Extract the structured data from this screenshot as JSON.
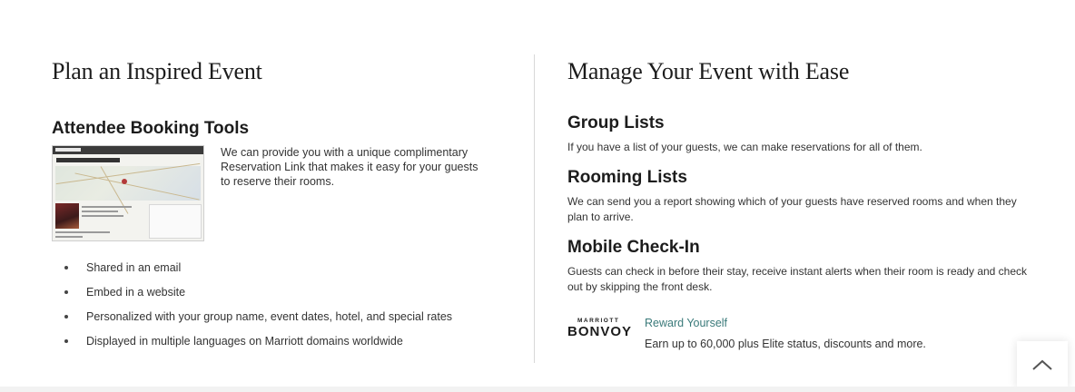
{
  "left": {
    "title": "Plan an Inspired Event",
    "subtitle": "Attendee Booking Tools",
    "description": "We can provide you with a unique complimentary Reservation Link that makes it easy for your guests to reserve their rooms.",
    "bullets": [
      "Shared in an email",
      "Embed in a website",
      "Personalized with your group name, event dates, hotel, and special rates",
      "Displayed in multiple languages on Marriott domains worldwide"
    ]
  },
  "right": {
    "title": "Manage Your Event with Ease",
    "sections": [
      {
        "heading": "Group Lists",
        "text": "If you have a list of your guests, we can make reservations for all of them."
      },
      {
        "heading": "Rooming Lists",
        "text": "We can send you a report showing which of your guests have reserved rooms and when they plan to arrive."
      },
      {
        "heading": "Mobile Check-In",
        "text": "Guests can check in before their stay, receive instant alerts when their room is ready and check out by skipping the front desk."
      }
    ],
    "bonvoy": {
      "logo_top": "MARRIOTT",
      "logo_main": "BONVOY",
      "link": "Reward Yourself",
      "text": "Earn up to 60,000 plus Elite status, discounts and more."
    }
  },
  "colors": {
    "link": "#3a7a7a",
    "text": "#333333",
    "divider": "#d8d8d8"
  },
  "icons": {
    "scroll_top": "chevron-up-icon"
  }
}
